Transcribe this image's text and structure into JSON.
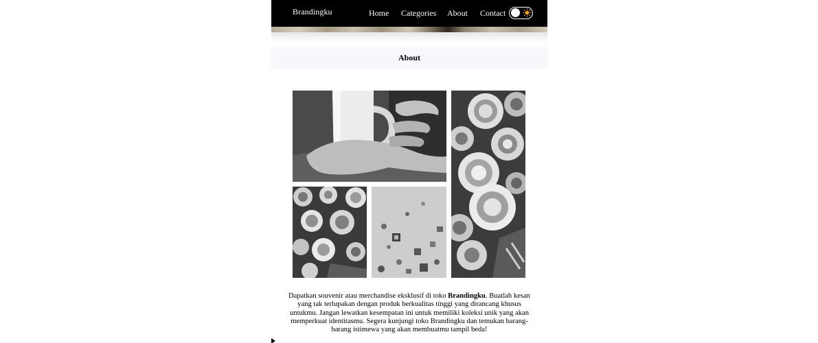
{
  "navbar": {
    "brand": "Brandingku",
    "links": [
      "Home",
      "Categories",
      "About",
      "Contact"
    ],
    "theme_toggle": {
      "state": "light",
      "icon": "sun-icon",
      "accent": "#f5a623"
    }
  },
  "section": {
    "title": "About"
  },
  "gallery": {
    "images": [
      {
        "name": "mug-in-hand-photo"
      },
      {
        "name": "decorative-plates-tall-photo"
      },
      {
        "name": "decorative-plates-small-photo"
      },
      {
        "name": "wall-souvenirs-photo"
      }
    ]
  },
  "description": {
    "before": "Dapatkan souvenir atau merchandise eksklusif di toko ",
    "brand": "Brandingku",
    "after": ". Buatlah kesan yang tak terlupakan dengan produk berkualitas tinggi yang dirancang khusus untukmu. Jangan lewatkan kesempatan ini untuk memiliki koleksi unik yang akan memperkuat identitasmu. Segera kunjungi toko Brandingku dan temukan barang-barang istimewa yang akan membuatmu tampil beda!"
  },
  "colors": {
    "navbar_bg": "#000000",
    "section_header_bg": "#f7f8fc",
    "text": "#000000"
  }
}
